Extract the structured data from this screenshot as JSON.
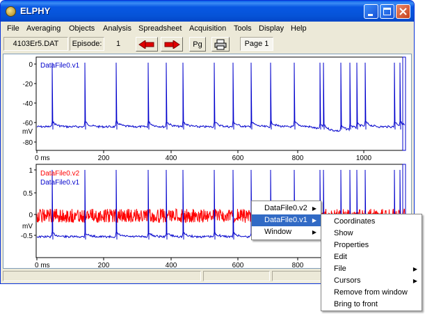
{
  "window": {
    "title": "ELPHY"
  },
  "menu": [
    "File",
    "Averaging",
    "Objects",
    "Analysis",
    "Spreadsheet",
    "Acquisition",
    "Tools",
    "Display",
    "Help"
  ],
  "toolbar": {
    "filename": "4103Er5.DAT",
    "episode_label": "Episode:",
    "episode_value": "1",
    "pg_label": "Pg",
    "page_label": "Page 1"
  },
  "plot_top": {
    "trace_label": "DataFile0.v1",
    "y_ticks": [
      "0",
      "-20",
      "-40",
      "-60",
      "-80"
    ],
    "y_unit": "mV",
    "x_ticks": [
      "0 ms",
      "200",
      "400",
      "600",
      "800",
      "1000"
    ]
  },
  "plot_bottom": {
    "trace_labels": [
      "DataFile0.v2",
      "DataFile0.v1"
    ],
    "y_ticks": [
      "1",
      "0.5",
      "0",
      "-0.5"
    ],
    "y_unit": "mV",
    "x_ticks": [
      "0 ms",
      "200",
      "400",
      "600",
      "800"
    ]
  },
  "context_menu": {
    "items": [
      {
        "label": "DataFile0.v2",
        "submenu": true
      },
      {
        "label": "DataFile0.v1",
        "submenu": true,
        "selected": true
      },
      {
        "label": "Window",
        "submenu": true
      }
    ]
  },
  "submenu": {
    "items": [
      {
        "label": "Coordinates",
        "submenu": false
      },
      {
        "label": "Show",
        "submenu": false
      },
      {
        "label": "Properties",
        "submenu": false
      },
      {
        "label": "Edit",
        "submenu": false
      },
      {
        "label": "File",
        "submenu": true
      },
      {
        "label": "Cursors",
        "submenu": true
      },
      {
        "label": "Remove from window",
        "submenu": false
      },
      {
        "label": "Bring to front",
        "submenu": false
      }
    ]
  },
  "colors": {
    "trace_v1": "#0000cc",
    "trace_v2": "#ff0000",
    "selection": "#316ac5",
    "titlebar": "#0654d8"
  },
  "icons": [
    "app-icon",
    "minimize-icon",
    "maximize-icon",
    "close-icon",
    "arrow-left-icon",
    "arrow-right-icon",
    "printer-icon",
    "submenu-arrow-icon"
  ]
}
